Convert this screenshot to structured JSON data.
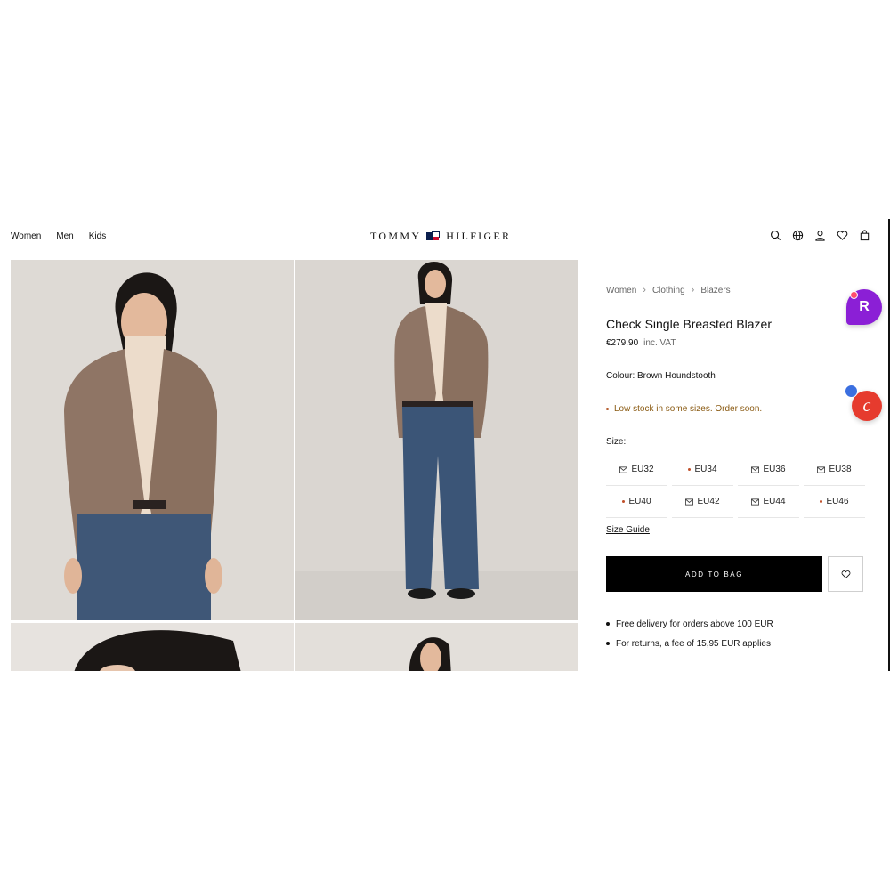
{
  "header": {
    "nav": [
      "Women",
      "Men",
      "Kids"
    ],
    "logo_left": "TOMMY",
    "logo_right": "HILFIGER",
    "icons": [
      "search-icon",
      "globe-icon",
      "account-icon",
      "wishlist-icon",
      "bag-icon"
    ]
  },
  "breadcrumb": [
    "Women",
    "Clothing",
    "Blazers"
  ],
  "product": {
    "title": "Check Single Breasted Blazer",
    "price": "€279.90",
    "vat": "inc. VAT",
    "colour": "Colour: Brown Houndstooth",
    "stock": "Low stock in some sizes. Order soon.",
    "size_label": "Size:",
    "sizes": [
      {
        "label": "EU32",
        "state": "notify"
      },
      {
        "label": "EU34",
        "state": "low"
      },
      {
        "label": "EU36",
        "state": "notify"
      },
      {
        "label": "EU38",
        "state": "notify"
      },
      {
        "label": "EU40",
        "state": "low"
      },
      {
        "label": "EU42",
        "state": "notify"
      },
      {
        "label": "EU44",
        "state": "notify"
      },
      {
        "label": "EU46",
        "state": "low"
      }
    ],
    "size_guide": "Size Guide",
    "add_to_bag": "ADD TO BAG",
    "benefits": [
      "Free delivery for orders above 100 EUR",
      "For returns, a fee of 15,95 EUR applies"
    ]
  },
  "extensions": {
    "r_label": "R",
    "c_label": "c"
  },
  "colors": {
    "stock_text": "#8a5a12",
    "low_dot": "#c0502a",
    "ext_purple": "#8b1fd6",
    "ext_red": "#e63b2e"
  }
}
